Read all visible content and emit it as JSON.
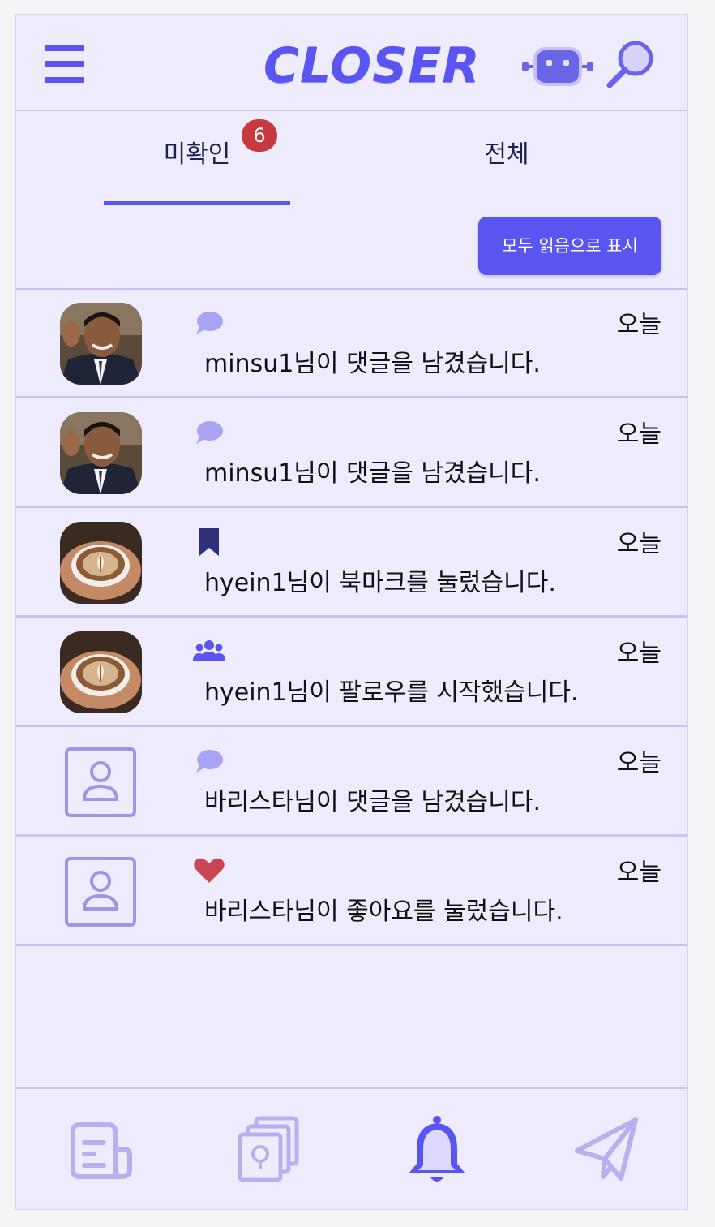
{
  "header": {
    "logo_text": "CLOSER",
    "menu_icon": "hamburger-menu-icon",
    "robot_icon": "robot-icon",
    "search_icon": "search-icon"
  },
  "tabs": [
    {
      "label": "미확인",
      "badge": "6",
      "active": true
    },
    {
      "label": "전체",
      "active": false
    }
  ],
  "mark_all_label": "모두 읽음으로 표시",
  "notifications": [
    {
      "avatar": "photo-man",
      "type_icon": "comment-icon",
      "text": "minsu1님이 댓글을 남겼습니다.",
      "time": "오늘"
    },
    {
      "avatar": "photo-man",
      "type_icon": "comment-icon",
      "text": "minsu1님이 댓글을 남겼습니다.",
      "time": "오늘"
    },
    {
      "avatar": "photo-coffee",
      "type_icon": "bookmark-icon",
      "text": "hyein1님이 북마크를 눌렀습니다.",
      "time": "오늘"
    },
    {
      "avatar": "photo-coffee",
      "type_icon": "users-icon",
      "text": "hyein1님이 팔로우를 시작했습니다.",
      "time": "오늘"
    },
    {
      "avatar": "default-user",
      "type_icon": "comment-icon",
      "text": "바리스타님이 댓글을 남겼습니다.",
      "time": "오늘"
    },
    {
      "avatar": "default-user",
      "type_icon": "heart-icon",
      "text": "바리스타님이 좋아요를 눌렀습니다.",
      "time": "오늘"
    }
  ],
  "bottom_nav": [
    {
      "icon": "document-icon",
      "active": false
    },
    {
      "icon": "idea-cards-icon",
      "active": false
    },
    {
      "icon": "bell-icon",
      "active": true
    },
    {
      "icon": "send-icon",
      "active": false
    }
  ],
  "colors": {
    "accent": "#5a55f0",
    "background": "#eeecfc",
    "divider": "#c9c4f2",
    "badge": "#c8383f",
    "inactive_icon": "#b8b0ee"
  }
}
